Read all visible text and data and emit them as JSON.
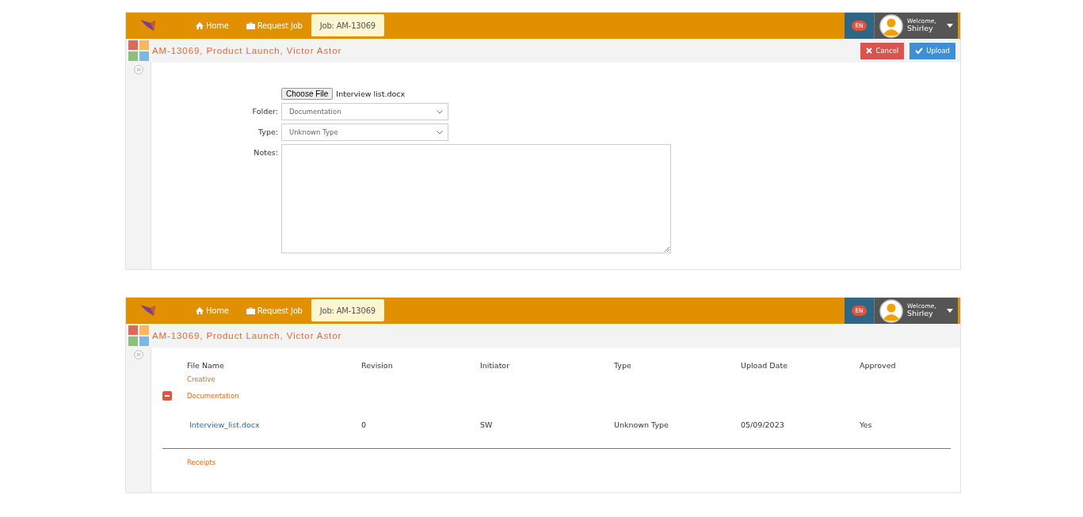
{
  "screens": [
    {
      "kind": "upload_form",
      "nav": [
        {
          "label": "Home",
          "kind": "home",
          "selected": false
        },
        {
          "label": "Request Job",
          "kind": "request",
          "selected": false
        },
        {
          "label": "Job: AM-13069",
          "kind": "job",
          "selected": true
        }
      ],
      "language": "EN",
      "welcome": "Welcome,",
      "user": "Shirley",
      "title": "AM-13069, Product Launch, Victor Astor",
      "actions": [
        {
          "label": "Cancel",
          "kind": "cancel"
        },
        {
          "label": "Upload",
          "kind": "upload"
        }
      ],
      "form": {
        "choose_file": "Choose File",
        "file_name": "Interview list.docx",
        "fields": [
          {
            "label": "Folder:",
            "kind": "select",
            "value": "Documentation"
          },
          {
            "label": "Type:",
            "kind": "select",
            "value": "Unknown Type"
          },
          {
            "label": "Notes:",
            "kind": "textarea"
          }
        ]
      }
    },
    {
      "kind": "file_list",
      "nav": [
        {
          "label": "Home",
          "kind": "home",
          "selected": false
        },
        {
          "label": "Request Job",
          "kind": "request",
          "selected": false
        },
        {
          "label": "Job: AM-13069",
          "kind": "job",
          "selected": true
        }
      ],
      "language": "EN",
      "welcome": "Welcome,",
      "user": "Shirley",
      "title": "AM-13069, Product Launch, Victor Astor",
      "table": {
        "columns": [
          "File Name",
          "Revision",
          "Initiator",
          "Type",
          "Upload Date",
          "Approved"
        ],
        "groups": [
          {
            "name": "Creative"
          },
          {
            "name": "Documentation",
            "expanded": true,
            "rows": [
              [
                "Interview_list.docx",
                "0",
                "SW",
                "Unknown Type",
                "05/09/2023",
                "Yes"
              ]
            ]
          },
          {
            "name": "Receipts"
          }
        ]
      }
    }
  ]
}
